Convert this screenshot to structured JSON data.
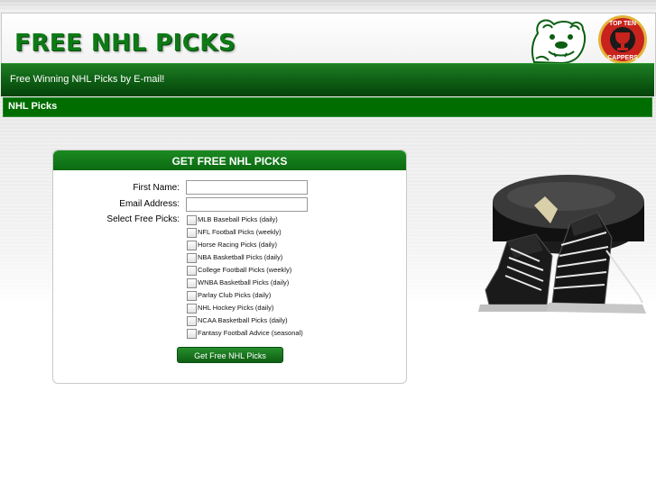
{
  "header": {
    "logo_text": "FREE NHL PICKS",
    "tagline": "Free Winning NHL Picks by E-mail!",
    "badge_text_top": "TOP TEN",
    "badge_text_bottom": "CAPPERS"
  },
  "section": {
    "title": "NHL Picks"
  },
  "form": {
    "title": "GET FREE NHL PICKS",
    "first_name_label": "First Name:",
    "email_label": "Email Address:",
    "picks_label": "Select Free Picks:",
    "first_name_value": "",
    "email_value": "",
    "options": [
      "MLB Baseball Picks (daily)",
      "NFL Football Picks (weekly)",
      "Horse Racing Picks (daily)",
      "NBA Basketball Picks (daily)",
      "College Football Picks (weekly)",
      "WNBA Basketball Picks (daily)",
      "Parlay Club Picks (daily)",
      "NHL Hockey Picks (daily)",
      "NCAA Basketball Picks (daily)",
      "Fantasy Football Advice (seasonal)"
    ],
    "submit_label": "Get Free NHL Picks"
  },
  "colors": {
    "brand_green": "#0e7a16",
    "bar_green": "#006d00",
    "badge_red": "#c8231d"
  },
  "icons": {
    "mascot": "bulldog-icon",
    "badge": "trophy-icon",
    "art": "hockey-puck-skates-icon"
  }
}
